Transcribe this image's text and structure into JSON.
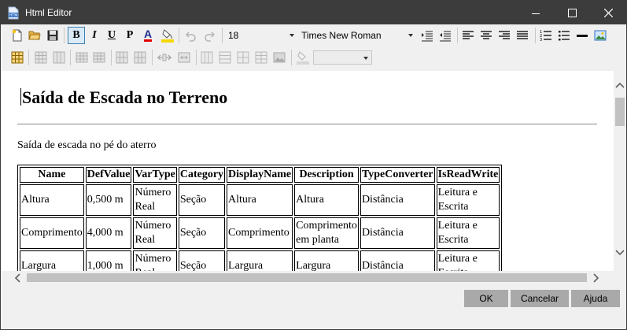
{
  "window": {
    "title": "Html Editor"
  },
  "toolbar1": {
    "icons": [
      "new-document-icon",
      "open-folder-icon",
      "save-icon",
      "bold-icon",
      "italic-icon",
      "underline-icon",
      "paragraph-icon",
      "font-color-icon",
      "highlight-color-icon",
      "undo-icon",
      "redo-icon",
      "indent-icon",
      "outdent-icon",
      "align-left-icon",
      "align-center-icon",
      "align-right-icon",
      "justify-icon",
      "numbered-list-icon",
      "bulleted-list-icon",
      "horizontal-rule-icon",
      "insert-image-icon"
    ],
    "bold_label": "B",
    "italic_label": "I",
    "underline_label": "U",
    "paragraph_label": "P",
    "font_color_label": "A",
    "font_color": "#e00000",
    "highlight_color": "#f5d800",
    "font_size": "18",
    "font_name": "Times New Roman"
  },
  "toolbar2": {
    "icons": [
      "insert-table-icon",
      "table-properties-icon",
      "insert-row-above-icon",
      "insert-row-below-icon",
      "insert-column-left-icon",
      "insert-column-right-icon",
      "delete-row-icon",
      "delete-column-icon",
      "merge-cells-icon",
      "split-cells-icon",
      "cell-properties-icon",
      "cell-align-icon",
      "cell-valign-icon",
      "table-image-icon",
      "fill-color-icon"
    ],
    "style_combo_value": ""
  },
  "document": {
    "heading": "Saída de Escada no Terreno",
    "description": "Saída de escada no pé do aterro",
    "table": {
      "headers": [
        "Name",
        "DefValue",
        "VarType",
        "Category",
        "DisplayName",
        "Description",
        "TypeConverter",
        "IsReadWrite"
      ],
      "rows": [
        [
          "Altura",
          "0,500 m",
          "Número Real",
          "Seção",
          "Altura",
          "Altura",
          "Distância",
          "Leitura e Escrita"
        ],
        [
          "Comprimento",
          "4,000 m",
          "Número Real",
          "Seção",
          "Comprimento",
          "Comprimento em planta",
          "Distância",
          "Leitura e Escrita"
        ],
        [
          "Largura",
          "1,000 m",
          "Número Real",
          "Seção",
          "Largura",
          "Largura",
          "Distância",
          "Leitura e Escrita"
        ]
      ]
    }
  },
  "buttons": {
    "ok": "OK",
    "cancel": "Cancelar",
    "help": "Ajuda"
  },
  "colors": {
    "titlebar": "#3c3c3c",
    "button": "#a9a9a9",
    "accent": "#3c7fb1"
  }
}
